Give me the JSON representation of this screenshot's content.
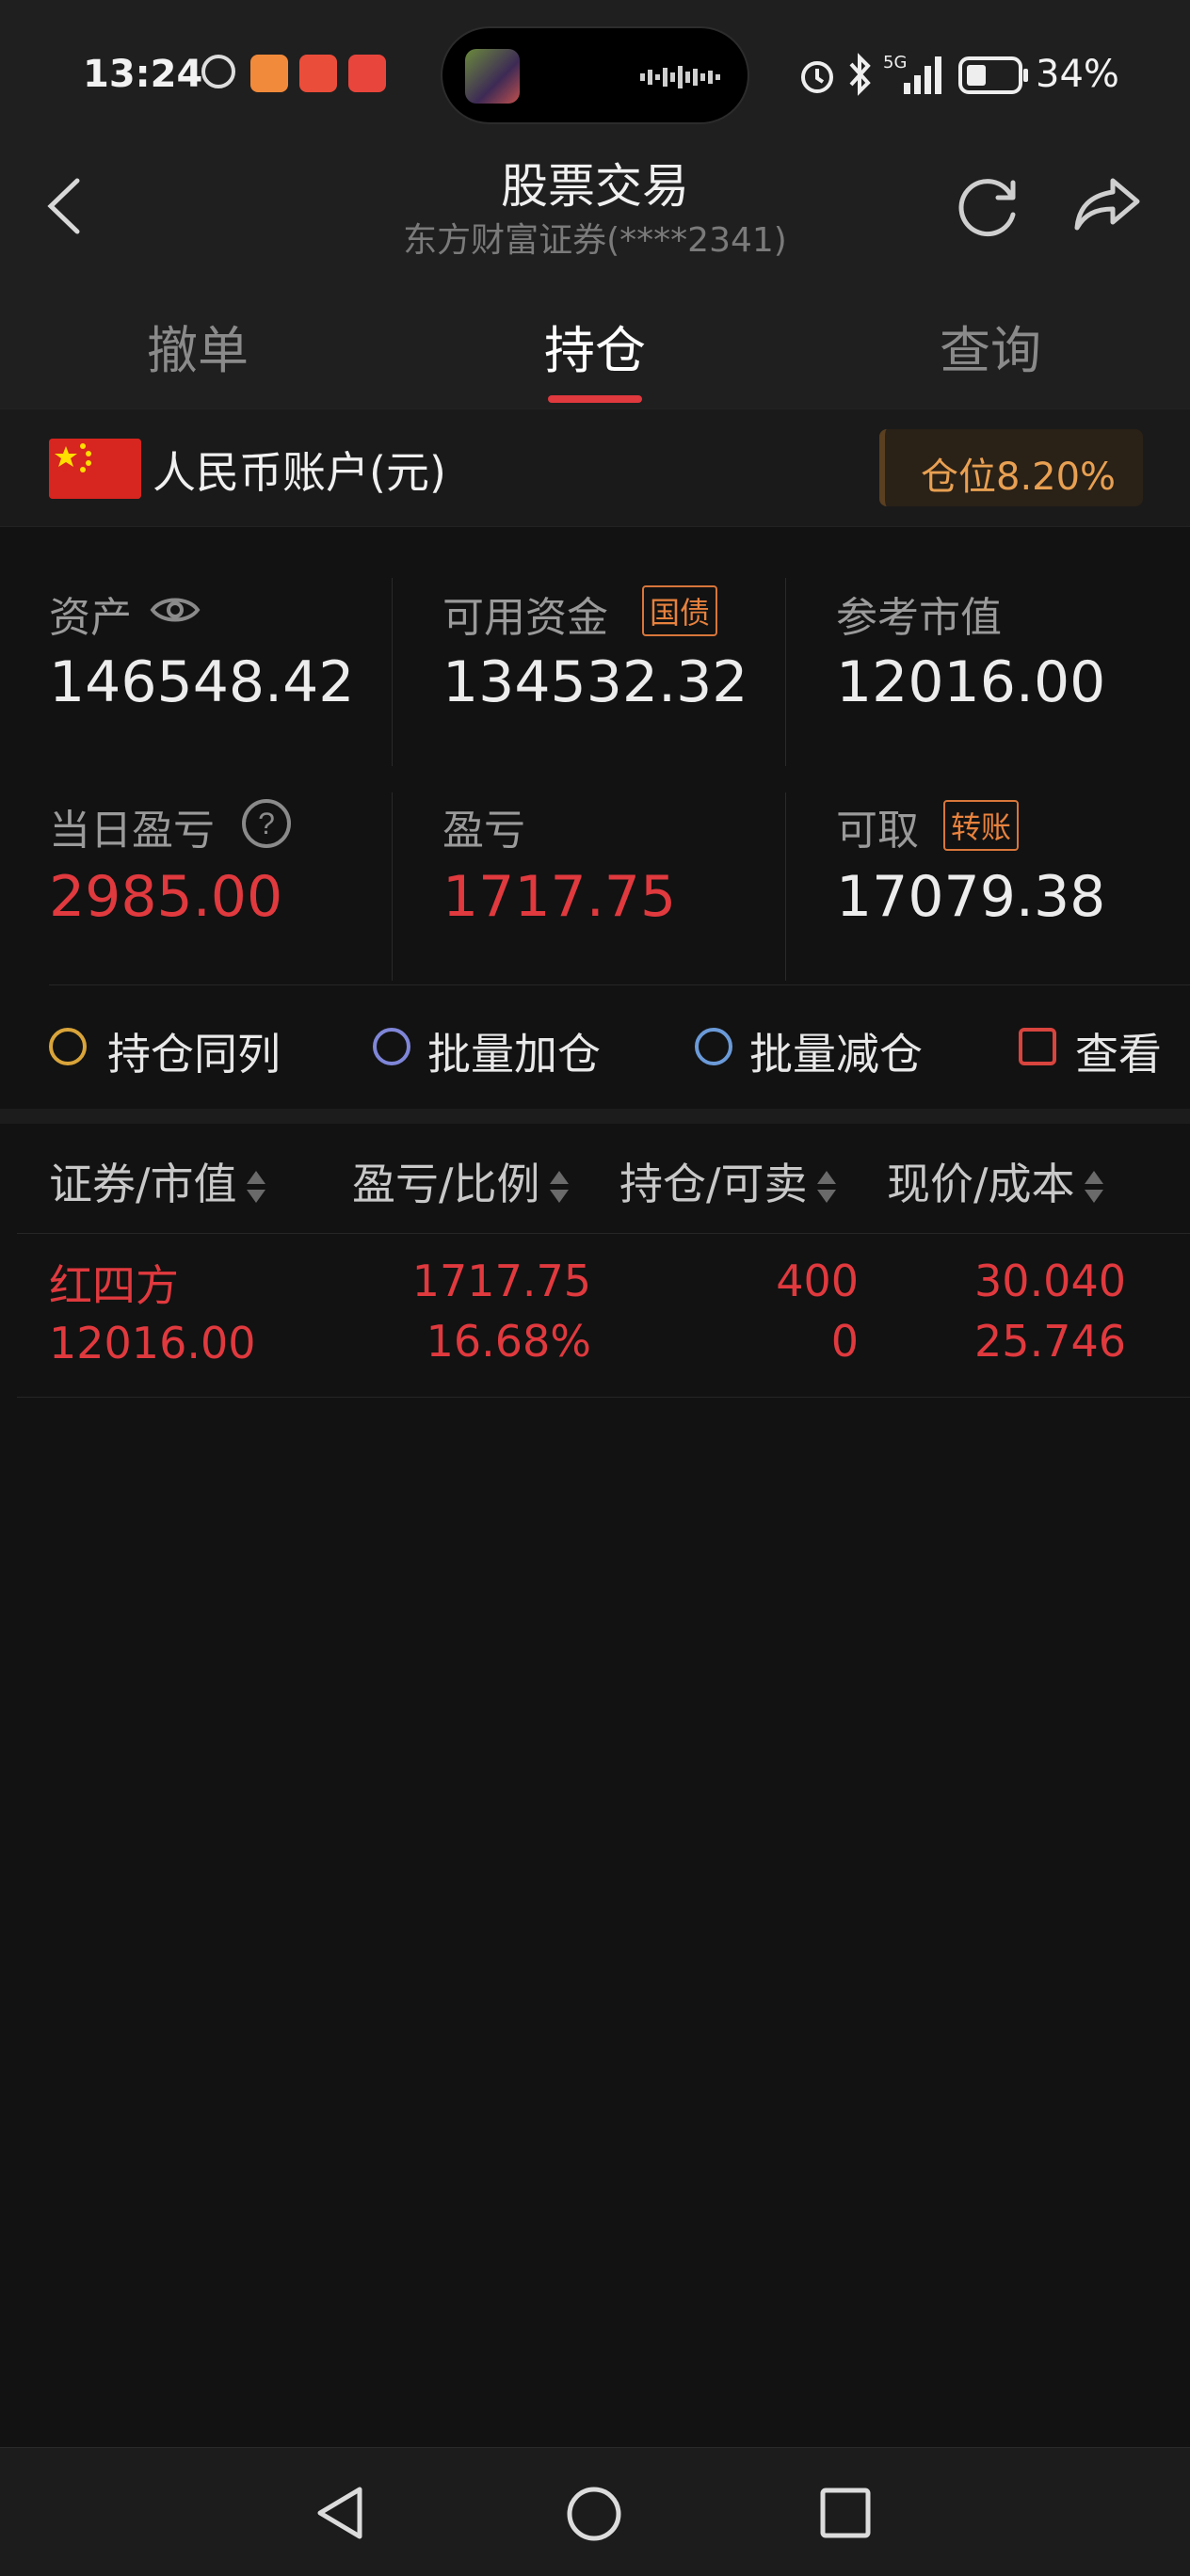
{
  "status_bar": {
    "time": "13:24",
    "battery": "34%",
    "network": "5G",
    "icons": [
      "notification-icon",
      "app-icon",
      "app-icon",
      "taobao-icon",
      "alarm-icon",
      "bluetooth-icon",
      "signal-icon",
      "battery-icon"
    ]
  },
  "header": {
    "title": "股票交易",
    "subtitle": "东方财富证券(****2341)"
  },
  "tabs": [
    {
      "label": "撤单"
    },
    {
      "label": "持仓",
      "active": true
    },
    {
      "label": "查询"
    }
  ],
  "account": {
    "label": "人民币账户(元)",
    "position_badge": "仓位8.20%"
  },
  "stats": {
    "assets_label": "资产",
    "assets_value": "146548.42",
    "available_label": "可用资金",
    "available_tag": "国债",
    "available_value": "134532.32",
    "market_label": "参考市值",
    "market_value": "12016.00",
    "daily_pl_label": "当日盈亏",
    "daily_pl_value": "2985.00",
    "pl_label": "盈亏",
    "pl_value": "1717.75",
    "withdraw_label": "可取",
    "withdraw_tag": "转账",
    "withdraw_value": "17079.38"
  },
  "shortcuts": [
    {
      "label": "持仓同列"
    },
    {
      "label": "批量加仓"
    },
    {
      "label": "批量减仓"
    },
    {
      "label": "查看"
    }
  ],
  "table": {
    "headers": [
      "证券/市值",
      "盈亏/比例",
      "持仓/可卖",
      "现价/成本"
    ],
    "rows": [
      {
        "name": "红四方",
        "market_value": "12016.00",
        "pl": "1717.75",
        "pl_ratio": "16.68%",
        "holding": "400",
        "sellable": "0",
        "price": "30.040",
        "cost": "25.746"
      }
    ]
  },
  "colors": {
    "accent_red": "#e0393e",
    "badge_orange": "#e8a052",
    "tag_orange": "#e8823e",
    "background": "#121212"
  }
}
